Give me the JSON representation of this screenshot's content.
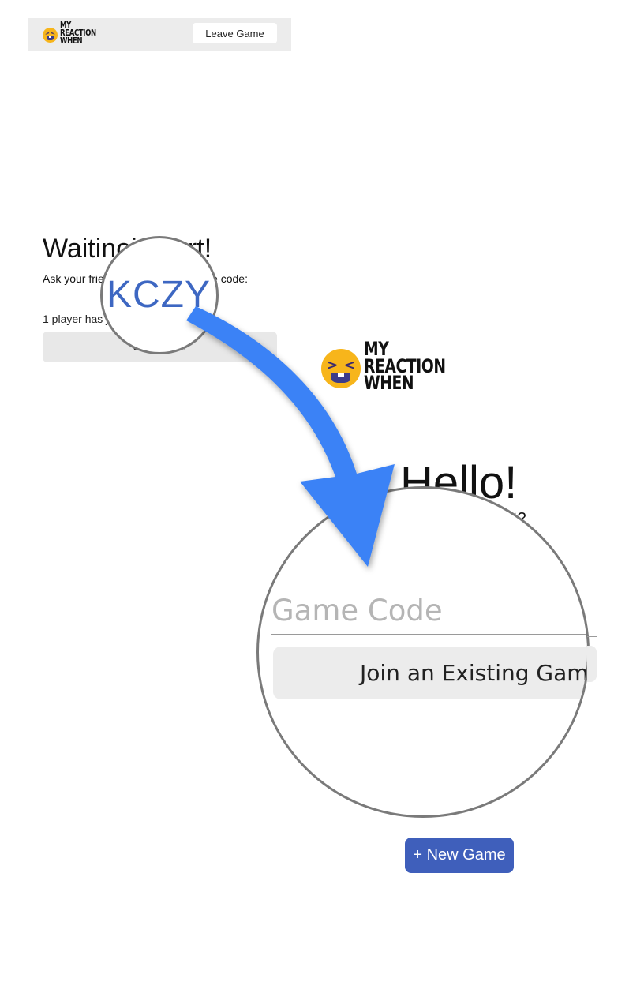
{
  "top_bar": {
    "logo_text": [
      "MY",
      "REACTION",
      "WHEN"
    ],
    "leave_button": "Leave Game"
  },
  "waiting": {
    "title": "Waitinoin usrt!",
    "ask_text": "Ask your frie",
    "ask_text_end": "game code:",
    "player_count": "1 player has j",
    "start_button": "Start now!"
  },
  "magnifier_code": {
    "code": "KCZY"
  },
  "home": {
    "logo_text": [
      "MY",
      "REACTION",
      "WHEN"
    ],
    "title": "Hello!",
    "subtitle_fragment": "ct?",
    "game_code_placeholder": "Game Code",
    "join_button": "Join an Existing Game",
    "new_game_button": "+ New Game"
  },
  "colors": {
    "accent_blue": "#3f5fbb",
    "arrow_blue": "#3b82f6",
    "logo_yellow": "#f7b51b"
  }
}
